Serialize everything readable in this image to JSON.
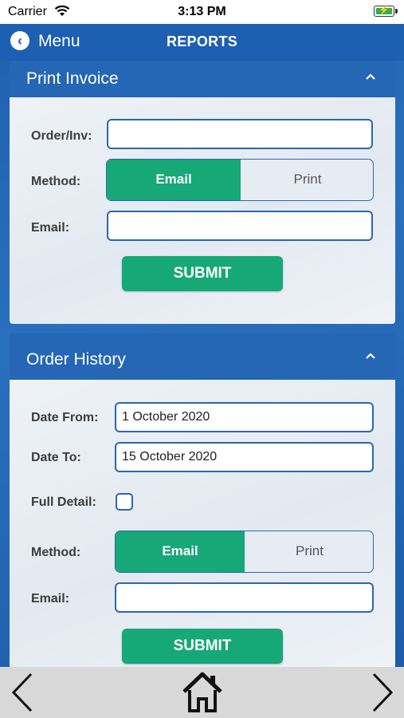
{
  "status": {
    "carrier": "Carrier",
    "time": "3:13 PM"
  },
  "nav": {
    "back_label": "Menu",
    "title": "REPORTS"
  },
  "print_invoice": {
    "title": "Print Invoice",
    "order_label": "Order/Inv:",
    "order_value": "",
    "method_label": "Method:",
    "method_options": [
      "Email",
      "Print"
    ],
    "method_selected": "Email",
    "email_label": "Email:",
    "email_value": "",
    "submit_label": "SUBMIT"
  },
  "order_history": {
    "title": "Order History",
    "date_from_label": "Date From:",
    "date_from_value": "1 October 2020",
    "date_to_label": "Date To:",
    "date_to_value": "15 October 2020",
    "full_detail_label": "Full Detail:",
    "full_detail_checked": false,
    "method_label": "Method:",
    "method_options": [
      "Email",
      "Print"
    ],
    "method_selected": "Email",
    "email_label": "Email:",
    "email_value": "",
    "submit_label": "SUBMIT"
  },
  "colors": {
    "primary_blue": "#1d5fb1",
    "accent_green": "#16a877"
  }
}
